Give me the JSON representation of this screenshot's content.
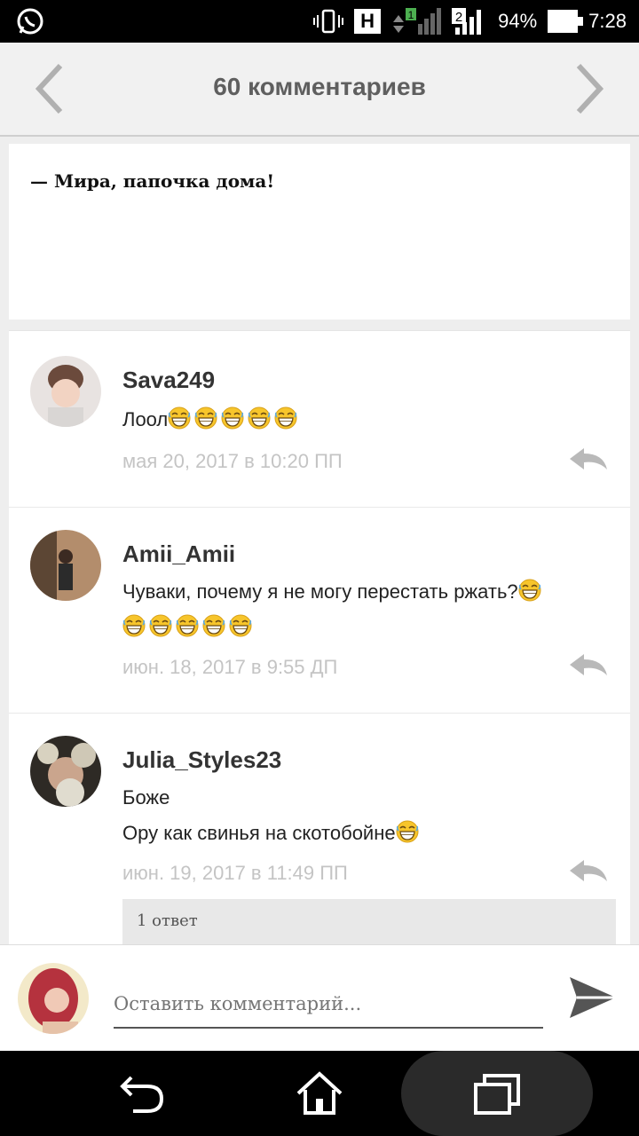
{
  "status_bar": {
    "network_letter": "H",
    "sim1": "1",
    "sim2": "2",
    "battery": "94%",
    "time": "7:28"
  },
  "header": {
    "title": "60 комментариев"
  },
  "story": {
    "text": "— Мира, папочка дома!"
  },
  "comments": [
    {
      "username": "Sava249",
      "lines": [
        "Лоол"
      ],
      "emoji_after": [
        5
      ],
      "date": "мая 20, 2017 в 10:20 ПП"
    },
    {
      "username": "Amii_Amii",
      "lines": [
        "Чуваки, почему я не могу перестать ржать?"
      ],
      "emoji_after": [
        1,
        5
      ],
      "date": "июн. 18, 2017 в 9:55 ДП"
    },
    {
      "username": "Julia_Styles23",
      "lines": [
        "Боже",
        "Ору как свинья на скотобойне"
      ],
      "emoji_after": [
        0,
        1
      ],
      "date": "июн. 19, 2017 в 11:49 ПП",
      "replies_label": "1 ответ"
    }
  ],
  "composer": {
    "placeholder": "Оставить комментарий..."
  },
  "icons": {
    "emoji": "grinning-squinting-emoji",
    "reply": "reply-arrow-icon",
    "send": "send-icon"
  },
  "colors": {
    "accent": "#5f5f5f",
    "date": "#c4c4c4",
    "emoji": "#f7c52b"
  }
}
